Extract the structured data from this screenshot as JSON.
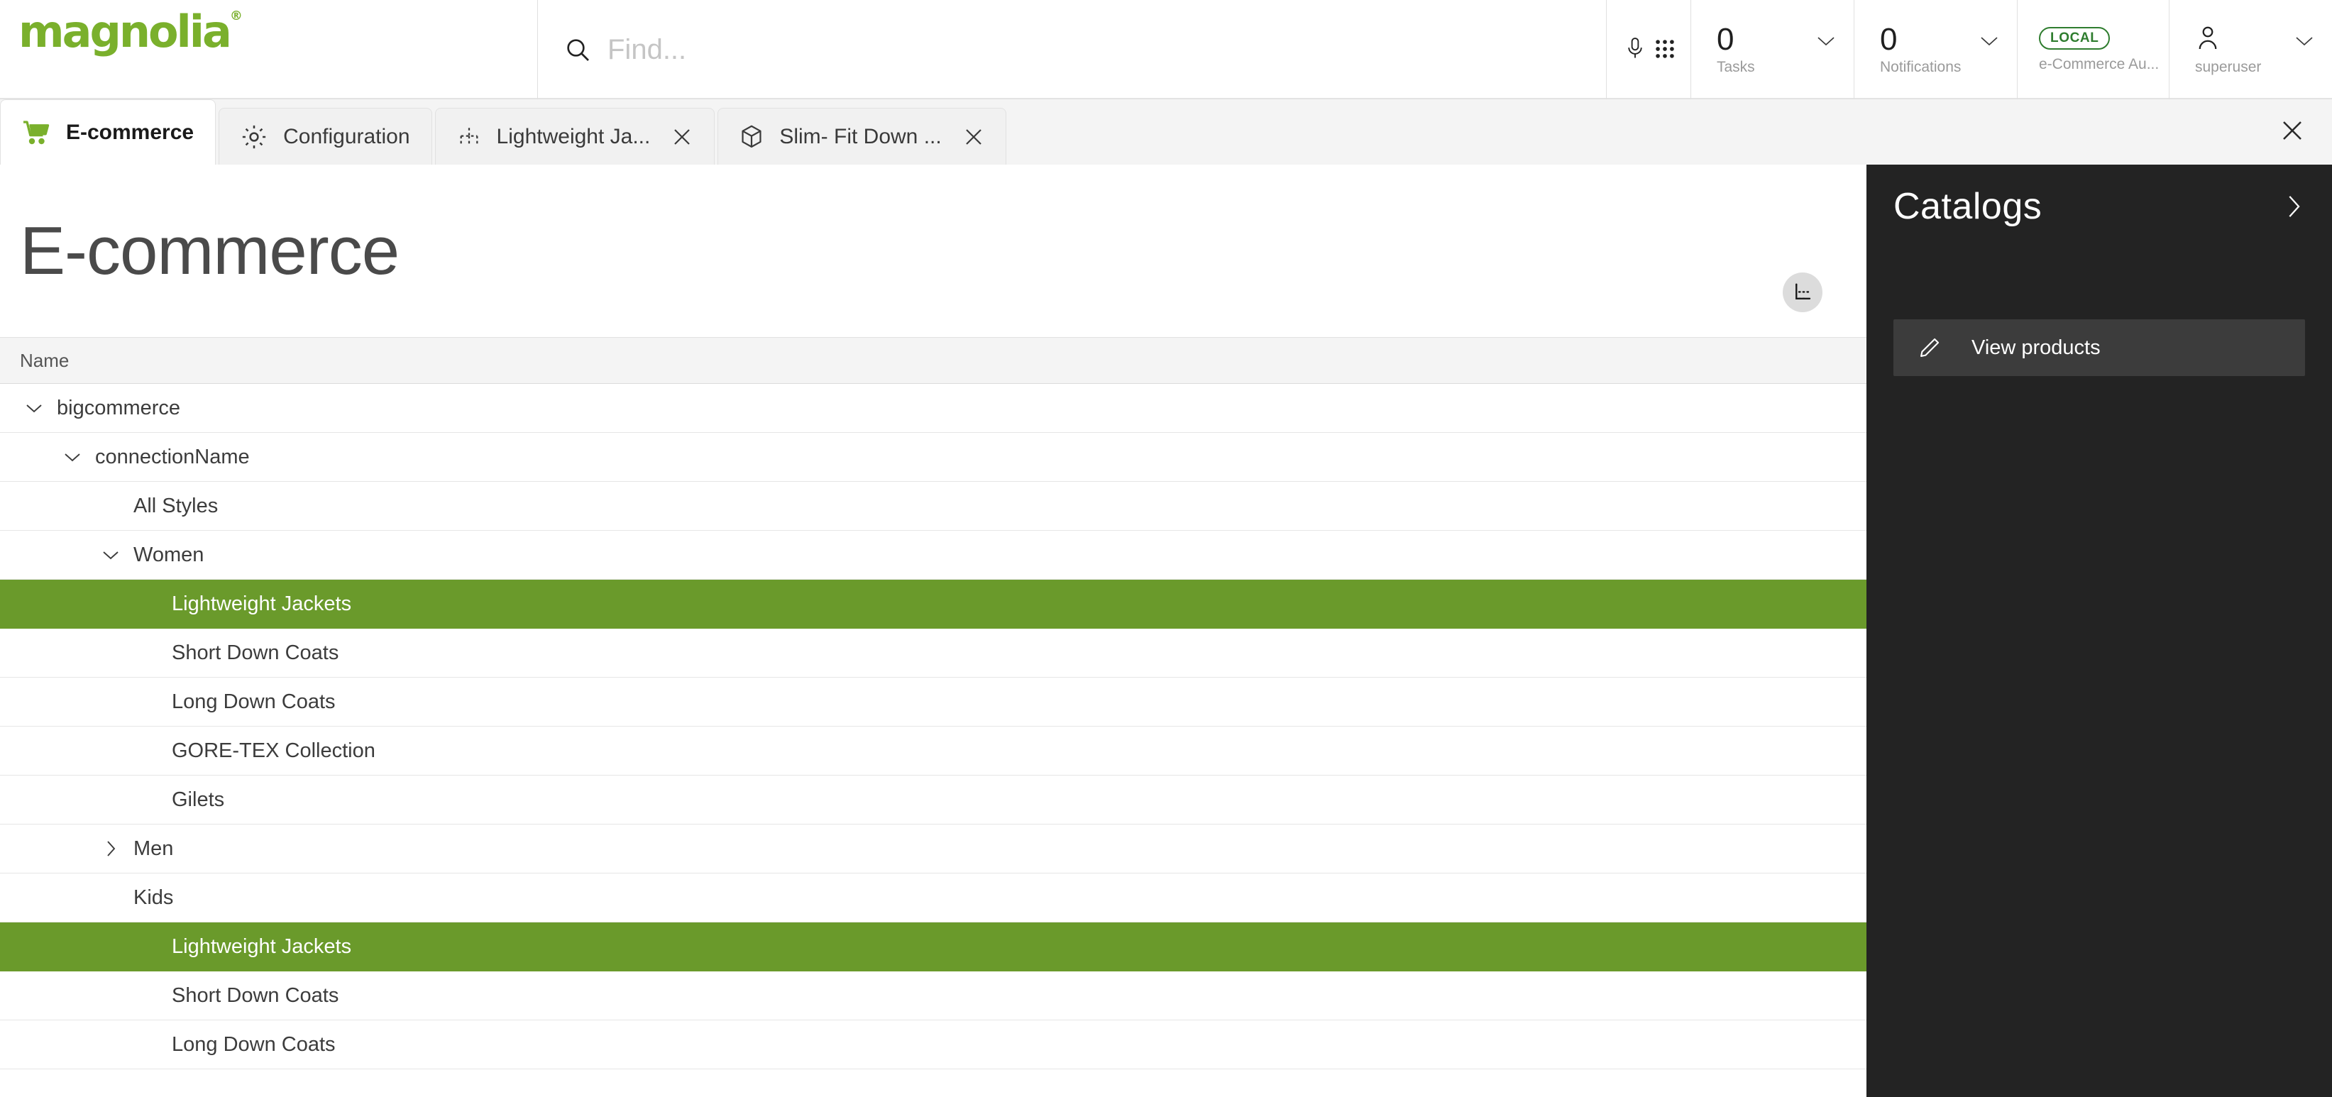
{
  "brand": {
    "logo_text": "magnolia",
    "registered_mark": "®"
  },
  "search": {
    "placeholder": "Find...",
    "value": "",
    "icon": "search-icon"
  },
  "header": {
    "mic_icon": "microphone-icon",
    "apps_icon": "apps-grid-icon",
    "tasks": {
      "count": "0",
      "label": "Tasks"
    },
    "notifications": {
      "count": "0",
      "label": "Notifications"
    },
    "environment": {
      "badge": "LOCAL",
      "name": "e-Commerce Au..."
    },
    "user": {
      "name": "superuser",
      "icon": "user-avatar-icon"
    }
  },
  "tabs": [
    {
      "label": "E-commerce",
      "icon": "shopping-cart-icon",
      "active": true,
      "closable": false
    },
    {
      "label": "Configuration",
      "icon": "gear-icon",
      "active": false,
      "closable": false
    },
    {
      "label": "Lightweight Ja...",
      "icon": "tree-hierarchy-icon",
      "active": false,
      "closable": true
    },
    {
      "label": "Slim- Fit Down ...",
      "icon": "cube-box-icon",
      "active": false,
      "closable": true
    }
  ],
  "tabbar": {
    "close_all_icon": "close-icon"
  },
  "main": {
    "page_title": "E-commerce",
    "title_action_icon": "tree-view-icon",
    "columns": [
      "Name"
    ],
    "rows": [
      {
        "label": "bigcommerce",
        "level": 0,
        "twisty": "down",
        "selected": false
      },
      {
        "label": "connectionName",
        "level": 1,
        "twisty": "down",
        "selected": false
      },
      {
        "label": "All Styles",
        "level": 2,
        "twisty": "none",
        "selected": false
      },
      {
        "label": "Women",
        "level": 2,
        "twisty": "down",
        "selected": false
      },
      {
        "label": "Lightweight Jackets",
        "level": 3,
        "twisty": "none",
        "selected": true
      },
      {
        "label": "Short Down Coats",
        "level": 3,
        "twisty": "none",
        "selected": false
      },
      {
        "label": "Long Down Coats",
        "level": 3,
        "twisty": "none",
        "selected": false
      },
      {
        "label": "GORE-TEX Collection",
        "level": 3,
        "twisty": "none",
        "selected": false
      },
      {
        "label": "Gilets",
        "level": 3,
        "twisty": "none",
        "selected": false
      },
      {
        "label": "Men",
        "level": 2,
        "twisty": "right",
        "selected": false
      },
      {
        "label": "Kids",
        "level": 2,
        "twisty": "none",
        "selected": false
      },
      {
        "label": "Lightweight Jackets",
        "level": 3,
        "twisty": "none",
        "selected": true
      },
      {
        "label": "Short Down Coats",
        "level": 3,
        "twisty": "none",
        "selected": false
      },
      {
        "label": "Long Down Coats",
        "level": 3,
        "twisty": "none",
        "selected": false
      }
    ]
  },
  "side_panel": {
    "title": "Catalogs",
    "expand_icon": "chevron-right-icon",
    "actions": [
      {
        "label": "View products",
        "icon": "pencil-edit-icon"
      }
    ]
  },
  "colors": {
    "brand_green": "#7ab02c",
    "selection_green": "#6a9a2b",
    "badge_green": "#2f7d2f",
    "panel_dark": "#232323",
    "panel_action": "#3c3c3c"
  }
}
